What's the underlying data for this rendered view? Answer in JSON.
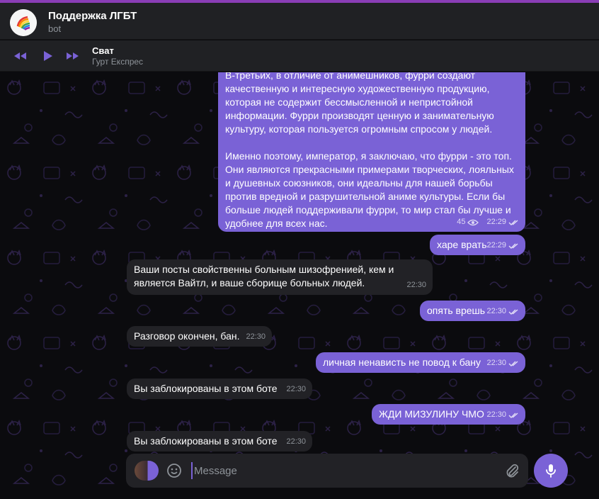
{
  "header": {
    "title": "Поддержка ЛГБТ",
    "subtitle": "bot"
  },
  "player": {
    "track_title": "Сват",
    "track_artist": "Гурт Експрес"
  },
  "messages": [
    {
      "direction": "outgoing",
      "paragraphs": [
        "В-третьих, в отличие от анимешников, фурри создают качественную и интересную художественную продукцию, которая не содержит бессмысленной и непристойной информации. Фурри производят ценную и занимательную культуру, которая пользуется огромным спросом у людей.",
        "Именно поэтому, император, я заключаю, что фурри - это топ. Они являются прекрасными примерами творческих, лояльных и душевных союзников, они идеальны для нашей борьбы против вредной и разрушительной аниме культуры. Если бы больше людей поддерживали фурри, то мир стал бы лучше и удобнее для всех нас."
      ],
      "views": "45",
      "time": "22:29"
    },
    {
      "direction": "outgoing",
      "text": "харе врать",
      "time": "22:29"
    },
    {
      "direction": "incoming",
      "text": "Ваши посты свойственны больным шизофренией, кем и является Вайтл, и ваше сборище больных людей.",
      "time": "22:30"
    },
    {
      "direction": "outgoing",
      "text": "опять врешь",
      "time": "22:30"
    },
    {
      "direction": "incoming",
      "text": "Разговор окончен, бан.",
      "time": "22:30"
    },
    {
      "direction": "outgoing",
      "text": "личная ненависть не повод к бану",
      "time": "22:30"
    },
    {
      "direction": "incoming",
      "text": "Вы заблокированы в этом боте",
      "time": "22:30"
    },
    {
      "direction": "outgoing",
      "text": "ЖДИ МИЗУЛИНУ ЧМО",
      "time": "22:30"
    },
    {
      "direction": "incoming",
      "text": "Вы заблокированы в этом боте",
      "time": "22:30"
    }
  ],
  "composer": {
    "placeholder": "Message"
  },
  "icons": {
    "prev": "rewind-icon",
    "play": "play-icon",
    "next": "fast-forward-icon",
    "emoji": "smile-icon",
    "attach": "paperclip-icon",
    "mic": "microphone-icon",
    "views": "eye-icon",
    "read": "double-check-icon"
  },
  "colors": {
    "accent": "#7a62d6",
    "outgoing_bubble": "#7a62d6",
    "incoming_bubble": "#222226",
    "header_bg": "#202124",
    "top_line": "#8a3db6"
  }
}
